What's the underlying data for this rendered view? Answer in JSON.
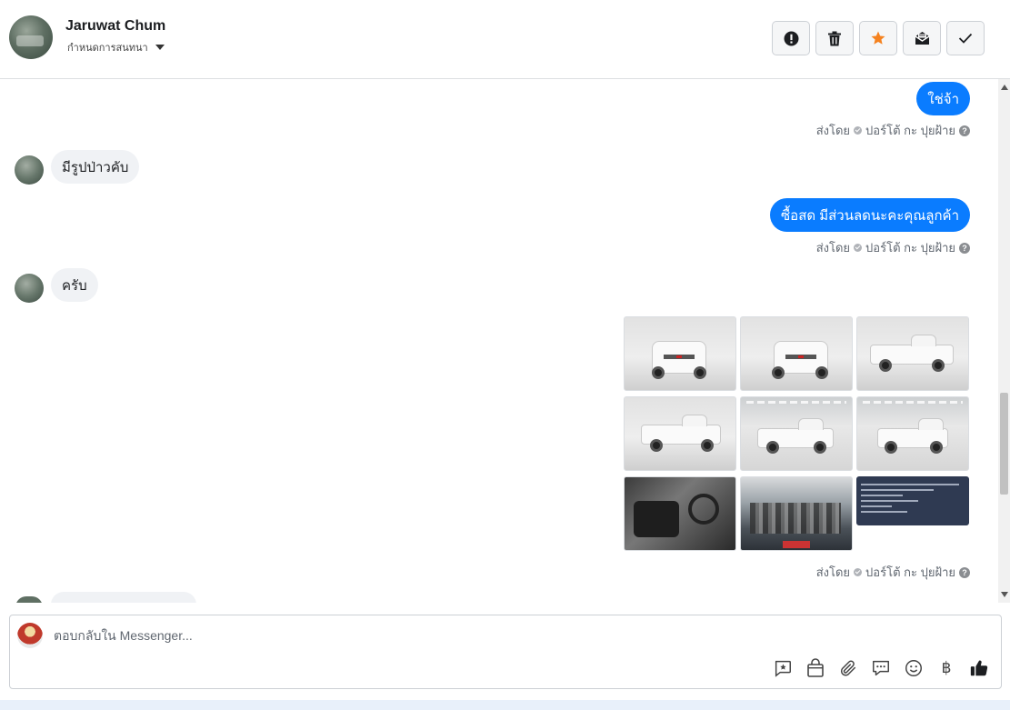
{
  "header": {
    "contact_name": "Jaruwat Chum",
    "assign_label": "กำหนดการสนทนา",
    "actions": [
      {
        "icon": "spam-alert-icon"
      },
      {
        "icon": "trash-icon"
      },
      {
        "icon": "star-icon",
        "color": "#f5821f"
      },
      {
        "icon": "mark-unread-icon"
      },
      {
        "icon": "checkmark-icon"
      }
    ]
  },
  "thread": {
    "messages": [
      {
        "direction": "out",
        "text": "ใช่จ้า"
      },
      {
        "direction": "in",
        "text": "มีรูปป่าวคับ"
      },
      {
        "direction": "out",
        "text": "ซื้อสด มีส่วนลดนะคะคุณลูกค้า"
      },
      {
        "direction": "in",
        "text": "ครับ"
      }
    ],
    "sent_by_label": "ส่งโดย",
    "sent_by_name": "ปอร์โต้ กะ ปุยฝ้าย",
    "help_glyph": "?",
    "photo_count": 9
  },
  "composer": {
    "placeholder": "ตอบกลับใน Messenger...",
    "tools": [
      "saved-reply-icon",
      "shop-bag-icon",
      "attachment-icon",
      "chat-bubbles-icon",
      "emoji-icon",
      "baht-icon",
      "thumbs-up-icon"
    ],
    "baht_glyph": "฿"
  },
  "colors": {
    "accent": "#0a7cff",
    "incoming_bubble": "#f0f2f5",
    "star": "#f5821f"
  }
}
